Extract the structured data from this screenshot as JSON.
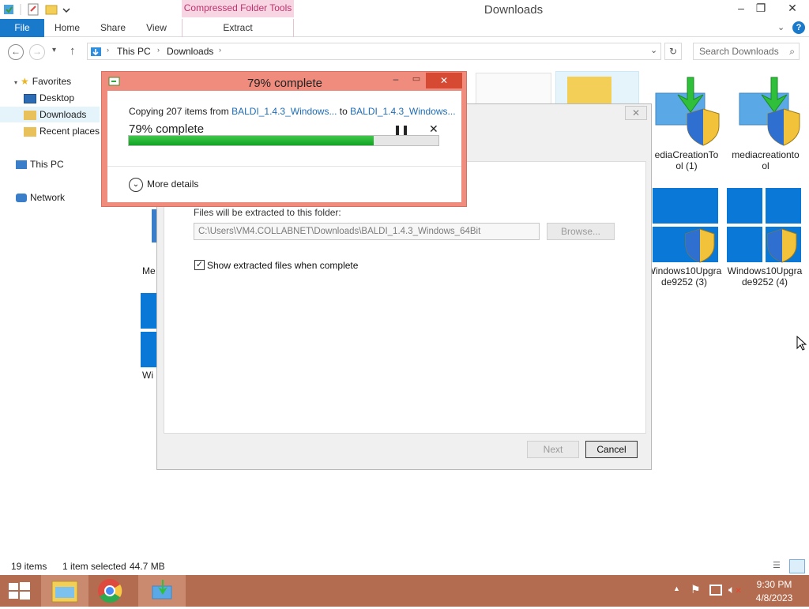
{
  "window": {
    "title": "Downloads",
    "context_tab": "Compressed Folder Tools"
  },
  "ribbon": {
    "tabs": [
      {
        "label": "File"
      },
      {
        "label": "Home"
      },
      {
        "label": "Share"
      },
      {
        "label": "View"
      },
      {
        "label": "Extract"
      }
    ]
  },
  "address": {
    "crumbs": [
      "This PC",
      "Downloads"
    ],
    "search_placeholder": "Search Downloads"
  },
  "nav": {
    "favorites": "Favorites",
    "items": [
      "Desktop",
      "Downloads",
      "Recent places"
    ],
    "this_pc": "This PC",
    "network": "Network"
  },
  "files": [
    {
      "name": "ediaCreationTo ol (1)"
    },
    {
      "name": "mediacreationto ol"
    },
    {
      "name": "Windows10Upgra de9252 (3)"
    },
    {
      "name": "Windows10Upgra de9252 (4)"
    },
    {
      "name": "Me"
    },
    {
      "name": "Wi"
    }
  ],
  "wizard": {
    "dest_label": "Files will be extracted to this folder:",
    "dest_path": "C:\\Users\\VM4.COLLABNET\\Downloads\\BALDI_1.4.3_Windows_64Bit",
    "browse": "Browse...",
    "show_files": "Show extracted files when complete",
    "show_files_checked": true,
    "next": "Next",
    "cancel": "Cancel"
  },
  "copy_dialog": {
    "title": "79% complete",
    "copying_prefix": "Copying 207 items from ",
    "from": "BALDI_1.4.3_Windows...",
    "to_word": " to ",
    "to": "BALDI_1.4.3_Windows...",
    "percent_text": "79% complete",
    "progress": 0.79,
    "more_details": "More details"
  },
  "status": {
    "items": "19 items",
    "selected": "1 item selected",
    "size": "44.7 MB"
  },
  "taskbar": {
    "time": "9:30 PM",
    "date": "4/8/2023"
  },
  "colors": {
    "accent": "#1979ca",
    "taskbar": "#b36c4f",
    "dialog_border": "#ef8c7e",
    "progress": "#10a323"
  }
}
